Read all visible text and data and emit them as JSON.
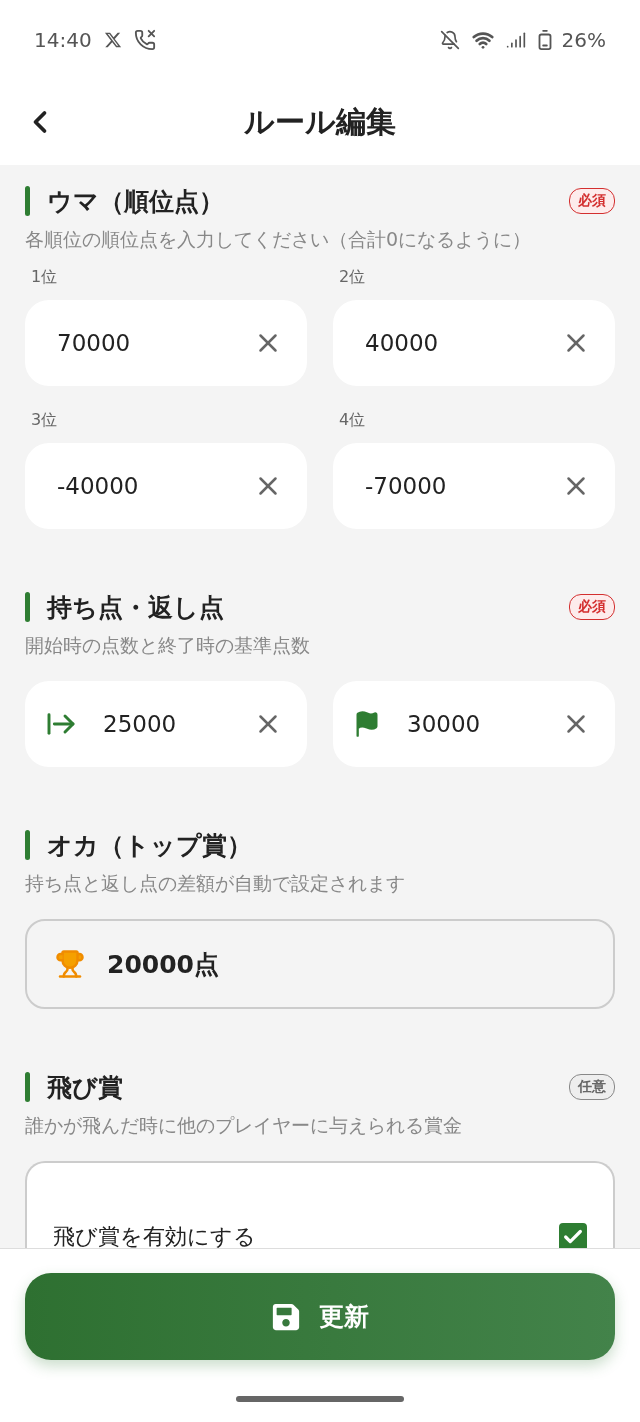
{
  "status_bar": {
    "time": "14:40",
    "battery": "26%"
  },
  "header": {
    "title": "ルール編集"
  },
  "sections": [
    {
      "kind": "rank_inputs",
      "title": "ウマ（順位点）",
      "badge": {
        "text": "必須",
        "kind": "required"
      },
      "description": "各順位の順位点を入力してください（合計0になるように）",
      "fields": [
        {
          "label": "1位",
          "value": "70000"
        },
        {
          "label": "2位",
          "value": "40000"
        },
        {
          "label": "3位",
          "value": "-40000"
        },
        {
          "label": "4位",
          "value": "-70000"
        }
      ]
    },
    {
      "kind": "icon_inputs",
      "title": "持ち点・返し点",
      "badge": {
        "text": "必須",
        "kind": "required"
      },
      "description": "開始時の点数と終了時の基準点数",
      "fields": [
        {
          "value": "25000"
        },
        {
          "value": "30000"
        }
      ]
    },
    {
      "kind": "display",
      "title": "オカ（トップ賞）",
      "description": "持ち点と返し点の差額が自動で設定されます",
      "value": "20000点"
    },
    {
      "kind": "toggle",
      "title": "飛び賞",
      "badge": {
        "text": "任意",
        "kind": "optional"
      },
      "description": "誰かが飛んだ時に他のプレイヤーに与えられる賞金",
      "toggle": {
        "label": "飛び賞を有効にする",
        "checked": true
      }
    }
  ],
  "footer": {
    "button": "更新"
  }
}
